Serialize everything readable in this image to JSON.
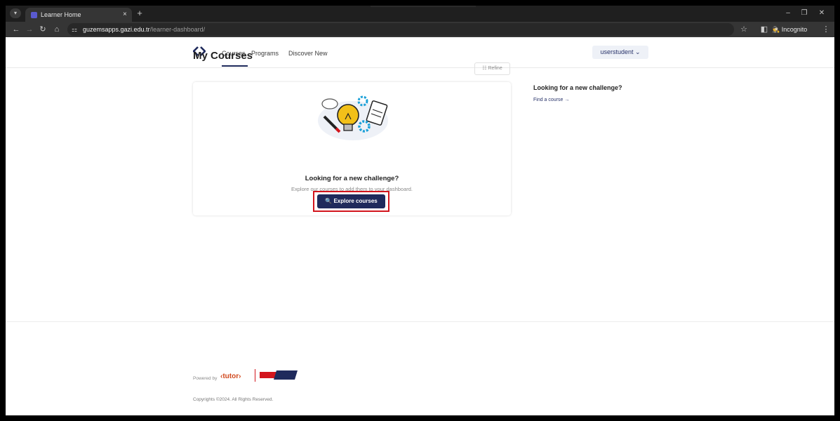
{
  "browser": {
    "tab_title": "Learner Home",
    "tab_close": "×",
    "new_tab": "+",
    "url_host": "guzemsapps.gazi.edu.tr",
    "url_path": "/learner-dashboard/",
    "incognito_label": "Incognito",
    "icons": {
      "menu": "▾",
      "back": "←",
      "forward": "→",
      "reload": "↻",
      "home": "⌂",
      "site_info": "⚏",
      "star": "☆",
      "panel": "◧",
      "kebab": "⋮",
      "minimize": "–",
      "restore": "❐",
      "close": "✕",
      "incognito": "🕵"
    }
  },
  "header": {
    "nav": [
      "Courses",
      "Programs",
      "Discover New"
    ],
    "user_menu": "userstudent ⌄"
  },
  "main": {
    "title": "My Courses",
    "refine_label": "☷ Refine",
    "empty_heading": "Looking for a new challenge?",
    "empty_sub": "Explore our courses to add them to your dashboard.",
    "explore_button": "🔍 Explore courses"
  },
  "sidebar": {
    "heading": "Looking for a new challenge?",
    "link": "Find a course →"
  },
  "footer": {
    "powered_by": "Powered by",
    "tutor_logo": "‹tutor›",
    "openedx_logo": "OPEN edX",
    "copyright": "Copyrights ©2024. All Rights Reserved."
  },
  "colors": {
    "primary": "#1f2a5c",
    "highlight": "#d3151d",
    "tutor_orange": "#d1491e",
    "chrome_dark": "#1f1f1f"
  }
}
